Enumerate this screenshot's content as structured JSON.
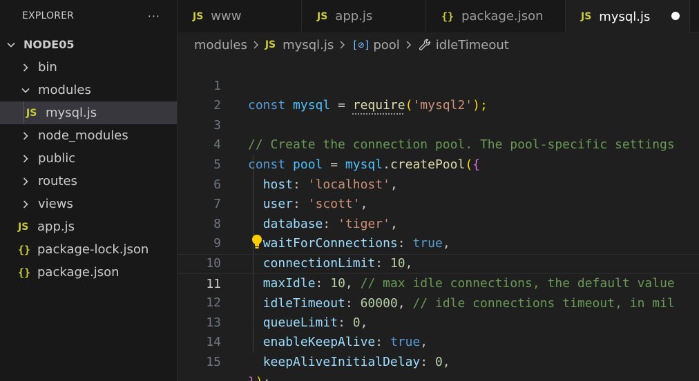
{
  "explorer": {
    "title": "EXPLORER",
    "more": "···",
    "items": [
      {
        "label": "NODE05",
        "kind": "root"
      },
      {
        "label": "bin",
        "kind": "folder"
      },
      {
        "label": "modules",
        "kind": "folder-open"
      },
      {
        "label": "mysql.js",
        "kind": "js",
        "icon": "JS"
      },
      {
        "label": "node_modules",
        "kind": "folder"
      },
      {
        "label": "public",
        "kind": "folder"
      },
      {
        "label": "routes",
        "kind": "folder"
      },
      {
        "label": "views",
        "kind": "folder"
      },
      {
        "label": "app.js",
        "kind": "js",
        "icon": "JS"
      },
      {
        "label": "package-lock.json",
        "kind": "json",
        "icon": "{}"
      },
      {
        "label": "package.json",
        "kind": "json",
        "icon": "{}"
      }
    ]
  },
  "tabs": [
    {
      "label": "www",
      "icon": "JS"
    },
    {
      "label": "app.js",
      "icon": "JS"
    },
    {
      "label": "package.json",
      "icon": "{}"
    },
    {
      "label": "mysql.js",
      "icon": "JS",
      "active": true,
      "dirty": true
    }
  ],
  "breadcrumb": {
    "folder": "modules",
    "file_icon": "JS",
    "file": "mysql.js",
    "symbol_icon": "[⊘]",
    "symbol": "pool",
    "property": "idleTimeout"
  },
  "editor": {
    "current_line": 11,
    "lines": [
      {
        "n": "1",
        "t": {
          "a": "const",
          "b": " ",
          "c": "mysql",
          "d": " = ",
          "e": "require",
          "f": "(",
          "g": "'mysql2'",
          "h": ");"
        }
      },
      {
        "n": "2"
      },
      {
        "n": "3",
        "t": {
          "a": "// Create the connection pool. The pool-specific settings"
        }
      },
      {
        "n": "4",
        "t": {
          "a": "const",
          "b": " ",
          "c": "pool",
          "d": " = ",
          "e": "mysql",
          "f": ".",
          "g": "createPool",
          "h": "(",
          "i": "{"
        }
      },
      {
        "n": "5",
        "t": {
          "a": "host",
          "b": ": ",
          "c": "'localhost'",
          "d": ","
        }
      },
      {
        "n": "6",
        "t": {
          "a": "user",
          "b": ": ",
          "c": "'scott'",
          "d": ","
        }
      },
      {
        "n": "7",
        "t": {
          "a": "database",
          "b": ": ",
          "c": "'tiger'",
          "d": ","
        }
      },
      {
        "n": "8",
        "t": {
          "a": "waitForConnections",
          "b": ": ",
          "c": "true",
          "d": ","
        }
      },
      {
        "n": "9",
        "t": {
          "a": "connectionLimit",
          "b": ": ",
          "c": "10",
          "d": ","
        }
      },
      {
        "n": "10",
        "t": {
          "a": "maxIdle",
          "b": ": ",
          "c": "10",
          "d": ", ",
          "e": "// max idle connections, the default value"
        }
      },
      {
        "n": "11",
        "t": {
          "a": "idleTimeout",
          "b": ": ",
          "c": "60000",
          "d": ", ",
          "e": "// idle connections timeout, in mil"
        }
      },
      {
        "n": "12",
        "t": {
          "a": "queueLimit",
          "b": ": ",
          "c": "0",
          "d": ","
        }
      },
      {
        "n": "13",
        "t": {
          "a": "enableKeepAlive",
          "b": ": ",
          "c": "true",
          "d": ","
        }
      },
      {
        "n": "14",
        "t": {
          "a": "keepAliveInitialDelay",
          "b": ": ",
          "c": "0",
          "d": ","
        }
      },
      {
        "n": "15",
        "t": {
          "a": "}",
          "b": ")",
          "c": ";"
        }
      }
    ]
  },
  "colors": {
    "js_icon": "#cbcb41",
    "keyword": "#569cd6",
    "string": "#ce9178",
    "comment": "#6a9955",
    "property": "#9cdcfe",
    "number": "#b5cea8",
    "function": "#dcdcaa"
  },
  "icons": {
    "lightbulb": "lightbulb-icon",
    "wrench": "wrench-icon",
    "chevron": "chevron-icon"
  }
}
